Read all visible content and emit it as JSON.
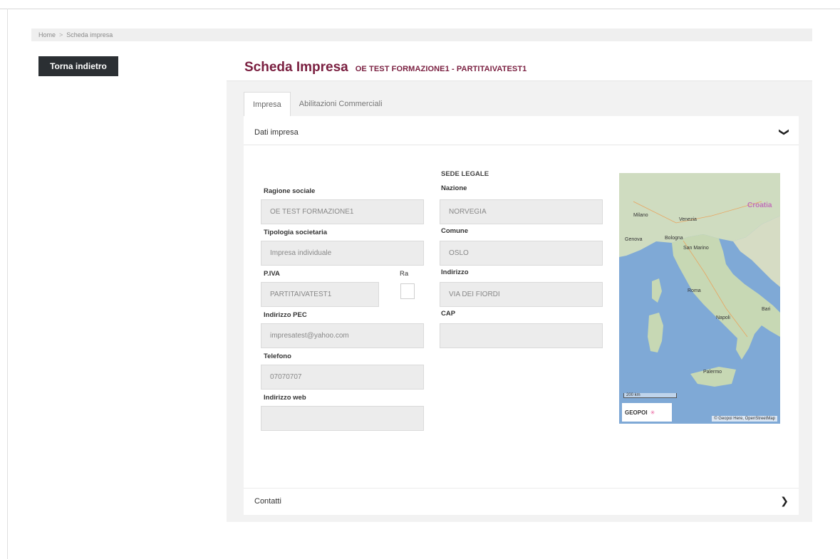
{
  "breadcrumb": {
    "home": "Home",
    "separator": ">",
    "current": "Scheda impresa"
  },
  "back_button": {
    "label": "Torna indietro"
  },
  "header": {
    "title": "Scheda Impresa",
    "subtitle": "OE TEST FORMAZIONE1 - PARTITAIVATEST1"
  },
  "tabs": [
    {
      "label": "Impresa",
      "active": true
    },
    {
      "label": "Abilitazioni Commerciali",
      "active": false
    }
  ],
  "sections": {
    "dati": {
      "label": "Dati impresa",
      "chevron": "chevron-down-icon",
      "chevron_glyph": "❯"
    },
    "contatti": {
      "label": "Contatti",
      "chevron": "chevron-right-icon",
      "chevron_glyph": "❯"
    }
  },
  "fields": {
    "ragione_sociale": {
      "label": "Ragione sociale",
      "value": "OE TEST FORMAZIONE1"
    },
    "tipologia": {
      "label": "Tipologia societaria",
      "value": "Impresa individuale"
    },
    "piva": {
      "label": "P.IVA",
      "value": "PARTITAIVATEST1"
    },
    "ra": {
      "label": "Ra",
      "checked": false
    },
    "pec": {
      "label": "Indirizzo PEC",
      "value": "impresatest@yahoo.com"
    },
    "telefono": {
      "label": "Telefono",
      "value": "07070707"
    },
    "web": {
      "label": "Indirizzo web",
      "value": ""
    }
  },
  "sede_legale": {
    "caption": "SEDE LEGALE",
    "nazione": {
      "label": "Nazione",
      "value": "NORVEGIA"
    },
    "comune": {
      "label": "Comune",
      "value": "OSLO"
    },
    "indirizzo": {
      "label": "Indirizzo",
      "value": "VIA DEI FIORDI"
    },
    "cap": {
      "label": "CAP",
      "value": ""
    }
  },
  "map": {
    "cities": [
      "Milano",
      "Venezia",
      "Genova",
      "Bologna",
      "San Marino",
      "Roma",
      "Napoli",
      "Bari",
      "Palermo"
    ],
    "country": "Croatia",
    "logo": "GEOPOI",
    "scale": "200 km",
    "attribution": "© Geopoi Here, OpenStreetMap",
    "colors": {
      "sea": "#7fa9d6",
      "land": "#cfdcc0"
    }
  }
}
